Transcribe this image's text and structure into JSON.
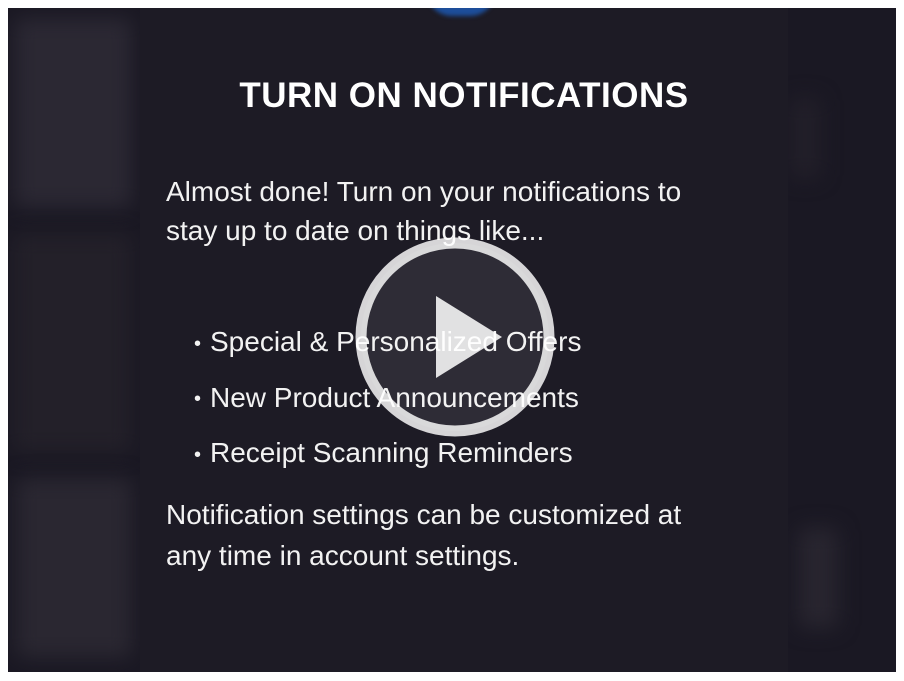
{
  "video": {
    "title": "TURN ON NOTIFICATIONS",
    "intro": "Almost done! Turn on your notifications to stay up to date on things like...",
    "bullets": [
      "Special & Personalized Offers",
      "New Product Announcements",
      "Receipt Scanning Reminders"
    ],
    "footer": "Notification settings can be customized at any time in account settings.",
    "play_icon": "play-icon"
  },
  "colors": {
    "background": "#1a1823",
    "panel": "#1d1b25",
    "text": "#ffffff",
    "accent_orb": "#1d4e9a"
  }
}
